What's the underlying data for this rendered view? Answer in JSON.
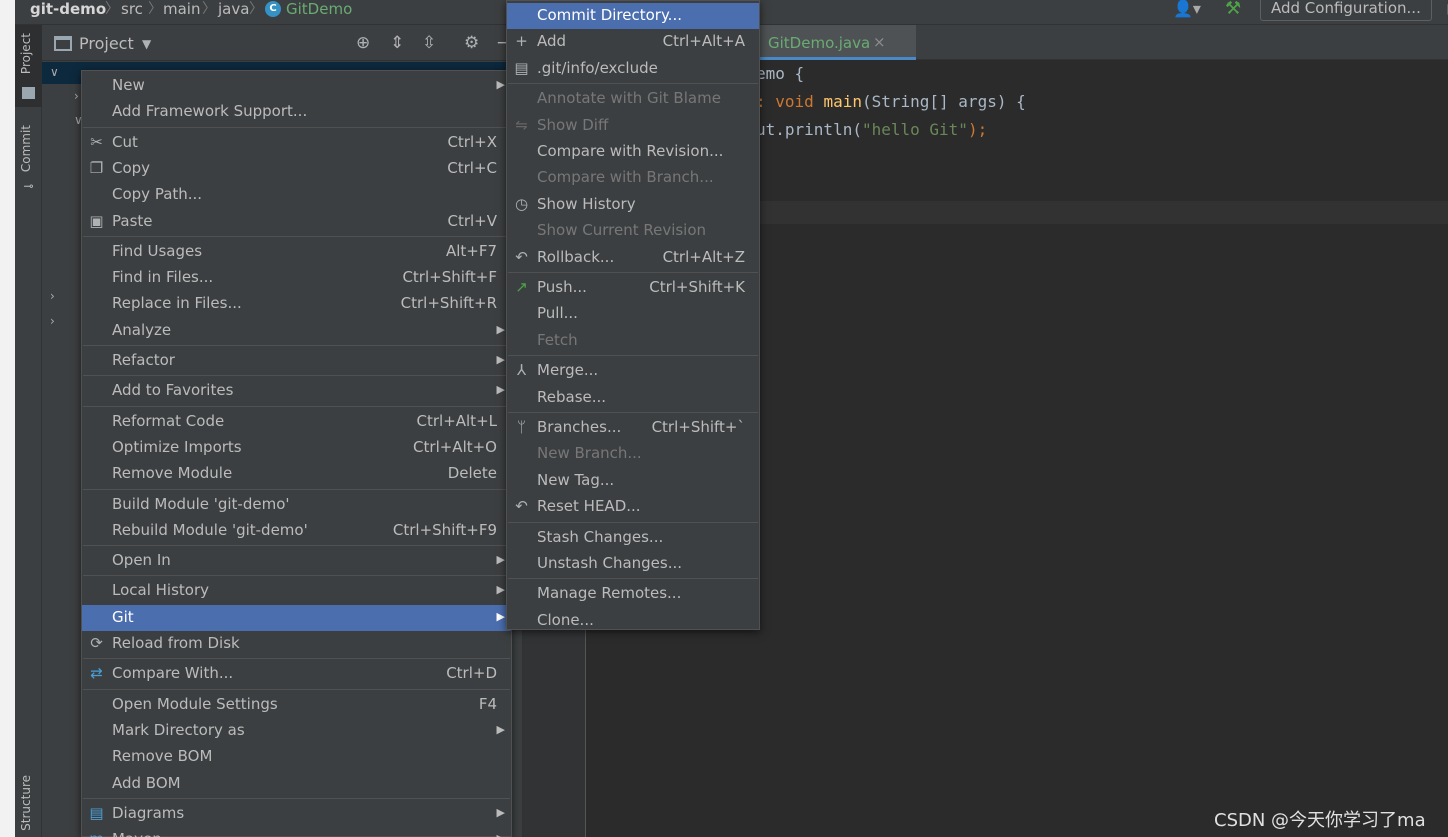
{
  "breadcrumb": {
    "items": [
      "git-demo",
      "src",
      "main",
      "java",
      "GitDemo"
    ],
    "class_icon_glyph": "C"
  },
  "toolbar": {
    "run_config_label": "Add Configuration..."
  },
  "stripe": {
    "project_tab": "Project",
    "commit_tab": "Commit",
    "structure_tab": "Structure"
  },
  "project_panel": {
    "title": "Project"
  },
  "editor": {
    "tab_label": "GitDemo.java",
    "tab_close": "×",
    "lines": [
      {
        "parts": [
          {
            "t": "emo {",
            "c": ""
          }
        ]
      },
      {
        "parts": [
          {
            "t": ": ",
            "c": "kw"
          },
          {
            "t": "void ",
            "c": "kw"
          },
          {
            "t": "main",
            "c": "fn"
          },
          {
            "t": "(String[] args) {",
            "c": ""
          }
        ]
      },
      {
        "parts": [
          {
            "t": "ut.println(",
            "c": ""
          },
          {
            "t": "\"hello Git\"",
            "c": "str"
          },
          {
            "t": ");",
            "c": "kw"
          }
        ]
      }
    ]
  },
  "context_menu": {
    "items": [
      {
        "label": "New",
        "shortcut": "",
        "submenu": true,
        "icon": "",
        "disabled": false,
        "selected": false
      },
      {
        "label": "Add Framework Support...",
        "shortcut": "",
        "submenu": false,
        "icon": "",
        "disabled": false,
        "selected": false
      },
      {
        "sep": true
      },
      {
        "label": "Cut",
        "shortcut": "Ctrl+X",
        "submenu": false,
        "icon": "scissors-icon",
        "disabled": false,
        "selected": false
      },
      {
        "label": "Copy",
        "shortcut": "Ctrl+C",
        "submenu": false,
        "icon": "copy-icon",
        "disabled": false,
        "selected": false
      },
      {
        "label": "Copy Path...",
        "shortcut": "",
        "submenu": false,
        "icon": "",
        "disabled": false,
        "selected": false
      },
      {
        "label": "Paste",
        "shortcut": "Ctrl+V",
        "submenu": false,
        "icon": "paste-icon",
        "disabled": false,
        "selected": false
      },
      {
        "sep": true
      },
      {
        "label": "Find Usages",
        "shortcut": "Alt+F7",
        "submenu": false,
        "icon": "",
        "disabled": false,
        "selected": false
      },
      {
        "label": "Find in Files...",
        "shortcut": "Ctrl+Shift+F",
        "submenu": false,
        "icon": "",
        "disabled": false,
        "selected": false
      },
      {
        "label": "Replace in Files...",
        "shortcut": "Ctrl+Shift+R",
        "submenu": false,
        "icon": "",
        "disabled": false,
        "selected": false
      },
      {
        "label": "Analyze",
        "shortcut": "",
        "submenu": true,
        "icon": "",
        "disabled": false,
        "selected": false
      },
      {
        "sep": true
      },
      {
        "label": "Refactor",
        "shortcut": "",
        "submenu": true,
        "icon": "",
        "disabled": false,
        "selected": false
      },
      {
        "sep": true
      },
      {
        "label": "Add to Favorites",
        "shortcut": "",
        "submenu": true,
        "icon": "",
        "disabled": false,
        "selected": false
      },
      {
        "sep": true
      },
      {
        "label": "Reformat Code",
        "shortcut": "Ctrl+Alt+L",
        "submenu": false,
        "icon": "",
        "disabled": false,
        "selected": false
      },
      {
        "label": "Optimize Imports",
        "shortcut": "Ctrl+Alt+O",
        "submenu": false,
        "icon": "",
        "disabled": false,
        "selected": false
      },
      {
        "label": "Remove Module",
        "shortcut": "Delete",
        "submenu": false,
        "icon": "",
        "disabled": false,
        "selected": false
      },
      {
        "sep": true
      },
      {
        "label": "Build Module 'git-demo'",
        "shortcut": "",
        "submenu": false,
        "icon": "",
        "disabled": false,
        "selected": false
      },
      {
        "label": "Rebuild Module 'git-demo'",
        "shortcut": "Ctrl+Shift+F9",
        "submenu": false,
        "icon": "",
        "disabled": false,
        "selected": false
      },
      {
        "sep": true
      },
      {
        "label": "Open In",
        "shortcut": "",
        "submenu": true,
        "icon": "",
        "disabled": false,
        "selected": false
      },
      {
        "sep": true
      },
      {
        "label": "Local History",
        "shortcut": "",
        "submenu": true,
        "icon": "",
        "disabled": false,
        "selected": false
      },
      {
        "label": "Git",
        "shortcut": "",
        "submenu": true,
        "icon": "",
        "disabled": false,
        "selected": true
      },
      {
        "label": "Reload from Disk",
        "shortcut": "",
        "submenu": false,
        "icon": "reload-icon",
        "disabled": false,
        "selected": false
      },
      {
        "sep": true
      },
      {
        "label": "Compare With...",
        "shortcut": "Ctrl+D",
        "submenu": false,
        "icon": "compare-icon",
        "disabled": false,
        "selected": false
      },
      {
        "sep": true
      },
      {
        "label": "Open Module Settings",
        "shortcut": "F4",
        "submenu": false,
        "icon": "",
        "disabled": false,
        "selected": false
      },
      {
        "label": "Mark Directory as",
        "shortcut": "",
        "submenu": true,
        "icon": "",
        "disabled": false,
        "selected": false
      },
      {
        "label": "Remove BOM",
        "shortcut": "",
        "submenu": false,
        "icon": "",
        "disabled": false,
        "selected": false
      },
      {
        "label": "Add BOM",
        "shortcut": "",
        "submenu": false,
        "icon": "",
        "disabled": false,
        "selected": false
      },
      {
        "sep": true
      },
      {
        "label": "Diagrams",
        "shortcut": "",
        "submenu": true,
        "icon": "diagram-icon",
        "disabled": false,
        "selected": false
      },
      {
        "label": "Maven",
        "shortcut": "",
        "submenu": true,
        "icon": "maven-icon",
        "disabled": false,
        "selected": false
      }
    ]
  },
  "git_menu": {
    "items": [
      {
        "label": "Commit Directory...",
        "shortcut": "",
        "icon": "",
        "disabled": false,
        "selected": true
      },
      {
        "label": "Add",
        "shortcut": "Ctrl+Alt+A",
        "icon": "plus-icon",
        "disabled": false,
        "selected": false
      },
      {
        "label": ".git/info/exclude",
        "shortcut": "",
        "icon": "file-icon",
        "disabled": false,
        "selected": false
      },
      {
        "sep": true
      },
      {
        "label": "Annotate with Git Blame",
        "shortcut": "",
        "icon": "",
        "disabled": true,
        "selected": false
      },
      {
        "label": "Show Diff",
        "shortcut": "",
        "icon": "diff-icon",
        "disabled": true,
        "selected": false
      },
      {
        "label": "Compare with Revision...",
        "shortcut": "",
        "icon": "",
        "disabled": false,
        "selected": false
      },
      {
        "label": "Compare with Branch...",
        "shortcut": "",
        "icon": "",
        "disabled": true,
        "selected": false
      },
      {
        "label": "Show History",
        "shortcut": "",
        "icon": "clock-icon",
        "disabled": false,
        "selected": false
      },
      {
        "label": "Show Current Revision",
        "shortcut": "",
        "icon": "",
        "disabled": true,
        "selected": false
      },
      {
        "label": "Rollback...",
        "shortcut": "Ctrl+Alt+Z",
        "icon": "undo-icon",
        "disabled": false,
        "selected": false
      },
      {
        "sep": true
      },
      {
        "label": "Push...",
        "shortcut": "Ctrl+Shift+K",
        "icon": "push-icon",
        "disabled": false,
        "selected": false
      },
      {
        "label": "Pull...",
        "shortcut": "",
        "icon": "",
        "disabled": false,
        "selected": false
      },
      {
        "label": "Fetch",
        "shortcut": "",
        "icon": "",
        "disabled": true,
        "selected": false
      },
      {
        "sep": true
      },
      {
        "label": "Merge...",
        "shortcut": "",
        "icon": "merge-icon",
        "disabled": false,
        "selected": false
      },
      {
        "label": "Rebase...",
        "shortcut": "",
        "icon": "",
        "disabled": false,
        "selected": false
      },
      {
        "sep": true
      },
      {
        "label": "Branches...",
        "shortcut": "Ctrl+Shift+`",
        "icon": "branch-icon",
        "disabled": false,
        "selected": false
      },
      {
        "label": "New Branch...",
        "shortcut": "",
        "icon": "",
        "disabled": true,
        "selected": false
      },
      {
        "label": "New Tag...",
        "shortcut": "",
        "icon": "",
        "disabled": false,
        "selected": false
      },
      {
        "label": "Reset HEAD...",
        "shortcut": "",
        "icon": "undo-icon",
        "disabled": false,
        "selected": false
      },
      {
        "sep": true
      },
      {
        "label": "Stash Changes...",
        "shortcut": "",
        "icon": "",
        "disabled": false,
        "selected": false
      },
      {
        "label": "Unstash Changes...",
        "shortcut": "",
        "icon": "",
        "disabled": false,
        "selected": false
      },
      {
        "sep": true
      },
      {
        "label": "Manage Remotes...",
        "shortcut": "",
        "icon": "",
        "disabled": false,
        "selected": false
      },
      {
        "label": "Clone...",
        "shortcut": "",
        "icon": "",
        "disabled": false,
        "selected": false
      }
    ]
  },
  "watermark": "CSDN @今天你学习了ma",
  "colors": {
    "selection": "#4b6eaf",
    "menu_bg": "#3c3f41",
    "editor_bg": "#2b2b2b",
    "class_green": "#6aab73"
  }
}
